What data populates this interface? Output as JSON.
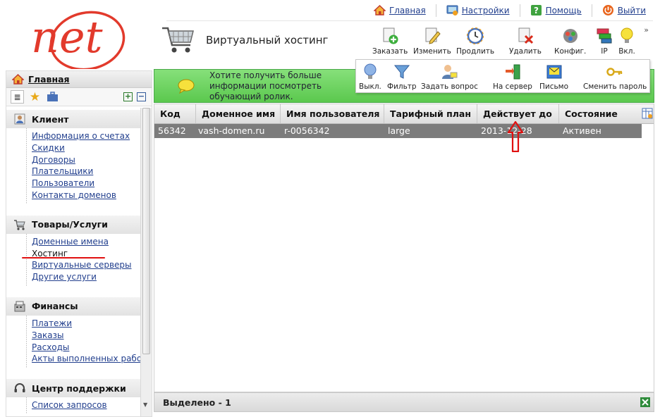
{
  "logo": {
    "text": "net",
    "color": "#e23a2c"
  },
  "top_links": [
    {
      "label": "Главная",
      "icon": "house-icon"
    },
    {
      "label": "Настройки",
      "icon": "settings-icon"
    },
    {
      "label": "Помощь",
      "icon": "help-icon"
    },
    {
      "label": "Выйти",
      "icon": "power-icon"
    }
  ],
  "page": {
    "title": "Виртуальный хостинг",
    "icon": "shopping-cart-icon"
  },
  "toolbar": {
    "buttons": [
      {
        "label": "Заказать",
        "icon": "order-plus-icon"
      },
      {
        "label": "Изменить",
        "icon": "edit-icon"
      },
      {
        "label": "Продлить",
        "icon": "renew-clock-icon"
      },
      {
        "label": "Удалить",
        "icon": "delete-icon"
      },
      {
        "label": "Конфиг.",
        "icon": "config-icon"
      },
      {
        "label": "IP",
        "icon": "ip-icon"
      },
      {
        "label": "Вкл.",
        "icon": "bulb-on-icon"
      }
    ],
    "more": "»"
  },
  "dropdown": {
    "buttons": [
      {
        "label": "Выкл.",
        "icon": "bulb-off-icon"
      },
      {
        "label": "Фильтр",
        "icon": "filter-icon"
      },
      {
        "label": "Задать вопрос",
        "icon": "ask-question-icon"
      },
      {
        "label": "На сервер",
        "icon": "to-server-icon"
      },
      {
        "label": "Письмо",
        "icon": "letter-icon"
      },
      {
        "label": "Сменить пароль",
        "icon": "key-icon"
      }
    ]
  },
  "sidebar": {
    "home": "Главная",
    "sections": [
      {
        "title": "Клиент",
        "icon": "client-icon",
        "items": [
          "Информация о счетах",
          "Скидки",
          "Договоры",
          "Плательщики",
          "Пользователи",
          "Контакты доменов"
        ]
      },
      {
        "title": "Товары/Услуги",
        "icon": "cart-icon",
        "items": [
          "Доменные имена",
          "Хостинг",
          "Виртуальные серверы",
          "Другие услуги"
        ]
      },
      {
        "title": "Финансы",
        "icon": "finance-icon",
        "items": [
          "Платежи",
          "Заказы",
          "Расходы",
          "Акты выполненных работ"
        ]
      },
      {
        "title": "Центр поддержки",
        "icon": "headset-icon",
        "items": [
          "Список запросов"
        ]
      }
    ]
  },
  "banner": {
    "text": "Хотите получить больше информации посмотреть обучающий ролик."
  },
  "table": {
    "columns": [
      "Код",
      "Доменное имя",
      "Имя пользователя",
      "Тарифный план",
      "Действует до",
      "Состояние"
    ],
    "rows": [
      [
        "56342",
        "vash-domen.ru",
        "r-0056342",
        "large",
        "2013-12-28",
        "Активен"
      ]
    ]
  },
  "footer": {
    "selected": "Выделено - 1"
  },
  "colors": {
    "accent_green": "#5bc84e",
    "selected_row": "#7c7c7c",
    "annotation_red": "#e01010"
  }
}
